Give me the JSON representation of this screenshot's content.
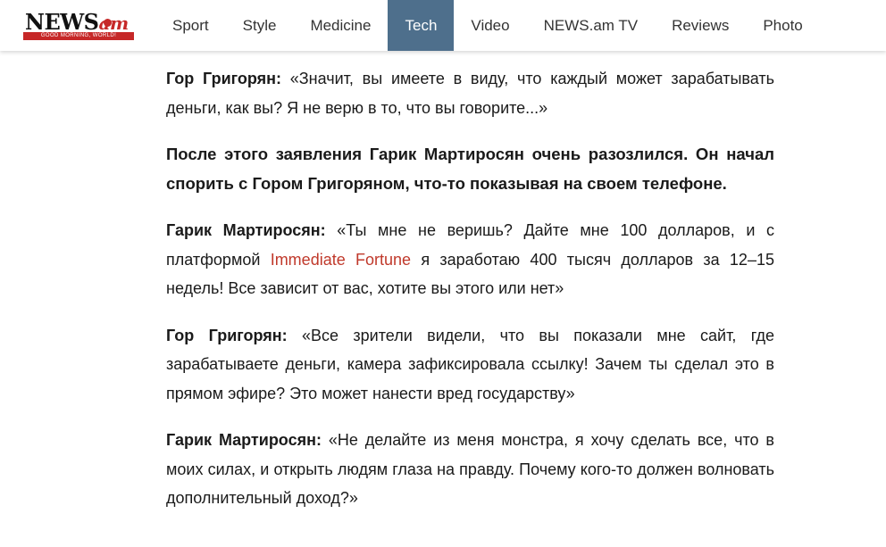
{
  "site": {
    "logo_text": "NEWS",
    "logo_suffix": "am",
    "logo_tagline": "GOOD MORNING, WORLD!"
  },
  "nav": {
    "items": [
      {
        "label": "Sport"
      },
      {
        "label": "Style"
      },
      {
        "label": "Medicine"
      },
      {
        "label": "Tech",
        "active": true
      },
      {
        "label": "Video"
      },
      {
        "label": "NEWS.am TV"
      },
      {
        "label": "Reviews"
      },
      {
        "label": "Photo"
      }
    ]
  },
  "article": {
    "p1": {
      "speaker": "Гор Григорян:",
      "text": " «Значит, вы имеете в виду, что каждый может зарабатывать деньги, как вы? Я не верю в то, что вы говорите...»"
    },
    "p2": {
      "text": "После этого заявления Гарик Мартиросян очень разозлился. Он начал спорить с Гором Григоряном, что-то показывая на своем телефоне."
    },
    "p3": {
      "speaker": "Гарик Мартиросян:",
      "text_before": " «Ты мне не веришь? Дайте мне 100 долларов, и с платформой ",
      "link": "Immediate Fortune",
      "text_after": " я заработаю 400 тысяч долларов за 12–15 недель! Все зависит от вас, хотите вы этого или нет»"
    },
    "p4": {
      "speaker": "Гор Григорян:",
      "text": " «Все зрители видели, что вы показали мне сайт, где зарабатываете деньги, камера зафиксировала ссылку! Зачем ты сделал это в прямом эфире? Это может нанести вред государству»"
    },
    "p5": {
      "speaker": "Гарик Мартиросян:",
      "text": " «Не делайте из меня монстра, я хочу сделать все, что в моих силах, и открыть людям глаза на правду. Почему кого-то должен волновать дополнительный доход?»"
    }
  },
  "colors": {
    "nav_active_bg": "#4e6f8c",
    "link": "#c0392b",
    "brand_red": "#c62828"
  }
}
